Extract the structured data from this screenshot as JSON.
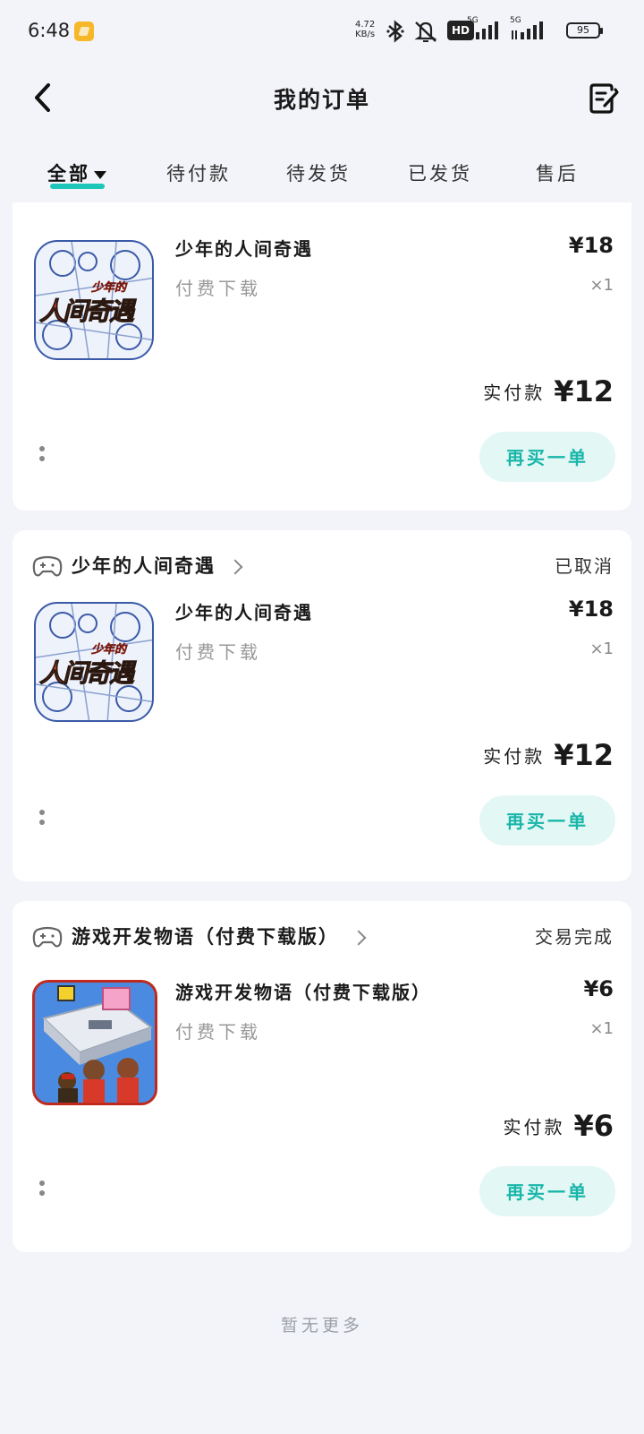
{
  "status_bar": {
    "time": "6:48",
    "net_speed_value": "4.72",
    "net_speed_unit": "KB/s",
    "hd_label": "HD",
    "sig1_label": "5G",
    "sig2_label": "5G",
    "battery": "95",
    "notification_color": "#f6b728"
  },
  "header": {
    "title": "我的订单"
  },
  "tabs": {
    "items": [
      {
        "label": "全部"
      },
      {
        "label": "待付款"
      },
      {
        "label": "待发货"
      },
      {
        "label": "已发货"
      },
      {
        "label": "售后"
      }
    ],
    "accent": "#1dc6b8"
  },
  "orders": [
    {
      "item_name": "少年的人间奇遇",
      "item_type": "付费下载",
      "price": "¥18",
      "qty": "×1",
      "paid_label": "实付款",
      "paid_amount": "¥12",
      "rebuy_label": "再买一单",
      "thumb_text_small": "少年的",
      "thumb_text_big": "人间奇遇"
    },
    {
      "game_name": "少年的人间奇遇",
      "status": "已取消",
      "item_name": "少年的人间奇遇",
      "item_type": "付费下载",
      "price": "¥18",
      "qty": "×1",
      "paid_label": "实付款",
      "paid_amount": "¥12",
      "rebuy_label": "再买一单",
      "thumb_text_small": "少年的",
      "thumb_text_big": "人间奇遇"
    },
    {
      "game_name": "游戏开发物语（付费下载版）",
      "status": "交易完成",
      "item_name": "游戏开发物语（付费下载版）",
      "item_type": "付费下载",
      "price": "¥6",
      "qty": "×1",
      "paid_label": "实付款",
      "paid_amount": "¥6",
      "rebuy_label": "再买一单"
    }
  ],
  "footer": {
    "text": "暂无更多"
  },
  "colors": {
    "background": "#f3f4f9",
    "button_bg": "#e3f7f5",
    "button_text": "#18b6a9"
  }
}
